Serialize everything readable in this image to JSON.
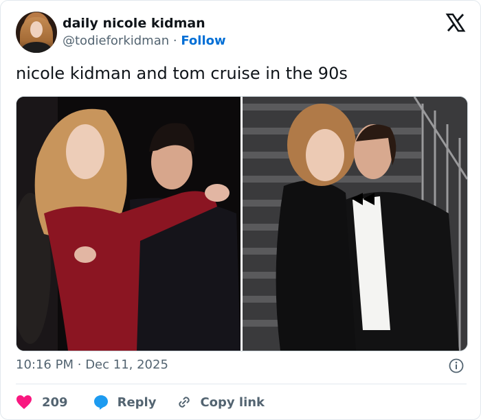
{
  "account": {
    "display_name": "daily nicole kidman",
    "handle": "@todieforkidman",
    "separator": "·",
    "follow_label": "Follow"
  },
  "tweet": {
    "text": "nicole kidman and tom cruise in the 90s"
  },
  "media": {
    "photos": [
      {
        "icon": "photo-couple-red-dress"
      },
      {
        "icon": "photo-couple-stairs"
      }
    ]
  },
  "meta": {
    "time": "10:16 PM",
    "separator": "·",
    "date": "Dec 11, 2025"
  },
  "actions": {
    "like_count": "209",
    "reply_label": "Reply",
    "copy_label": "Copy link"
  },
  "colors": {
    "link": "#006fd6",
    "like": "#f91880",
    "reply": "#1d9bf0",
    "muted": "#536471"
  }
}
